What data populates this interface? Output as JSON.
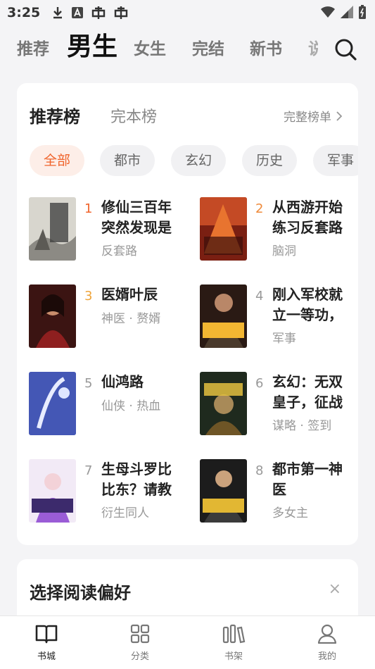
{
  "status_bar": {
    "time": "3:25"
  },
  "top_tabs": [
    {
      "label": "推荐",
      "active": false
    },
    {
      "label": "男生",
      "active": true
    },
    {
      "label": "女生",
      "active": false
    },
    {
      "label": "完结",
      "active": false
    },
    {
      "label": "新书",
      "active": false
    },
    {
      "label": "说",
      "active": false
    }
  ],
  "ranking": {
    "title": "推荐榜",
    "alt_title": "完本榜",
    "full_list_label": "完整榜单",
    "chips": [
      "全部",
      "都市",
      "玄幻",
      "历史",
      "军事"
    ],
    "books": [
      {
        "rank": "1",
        "title": "修仙三百年突然发现是",
        "tags": "反套路"
      },
      {
        "rank": "2",
        "title": "从西游开始练习反套路",
        "tags": "脑洞"
      },
      {
        "rank": "3",
        "title": "医婿叶辰",
        "tags": "神医 · 赘婿"
      },
      {
        "rank": "4",
        "title": "刚入军校就立一等功，",
        "tags": "军事"
      },
      {
        "rank": "5",
        "title": "仙鸿路",
        "tags": "仙侠 · 热血"
      },
      {
        "rank": "6",
        "title": "玄幻：无双皇子，征战",
        "tags": "谋略 · 签到"
      },
      {
        "rank": "7",
        "title": "生母斗罗比比东？请教",
        "tags": "衍生同人"
      },
      {
        "rank": "8",
        "title": "都市第一神医",
        "tags": "多女主"
      }
    ]
  },
  "preference": {
    "title": "选择阅读偏好",
    "close": "×"
  },
  "bottom_nav": [
    {
      "label": "书城",
      "icon": "book-open-icon",
      "active": true
    },
    {
      "label": "分类",
      "icon": "grid-icon",
      "active": false
    },
    {
      "label": "书架",
      "icon": "bookshelf-icon",
      "active": false
    },
    {
      "label": "我的",
      "icon": "user-icon",
      "active": false
    }
  ],
  "colors": {
    "accent": "#f0642c",
    "chip_active_bg": "#fdeee8",
    "background": "#f4f4f6"
  }
}
